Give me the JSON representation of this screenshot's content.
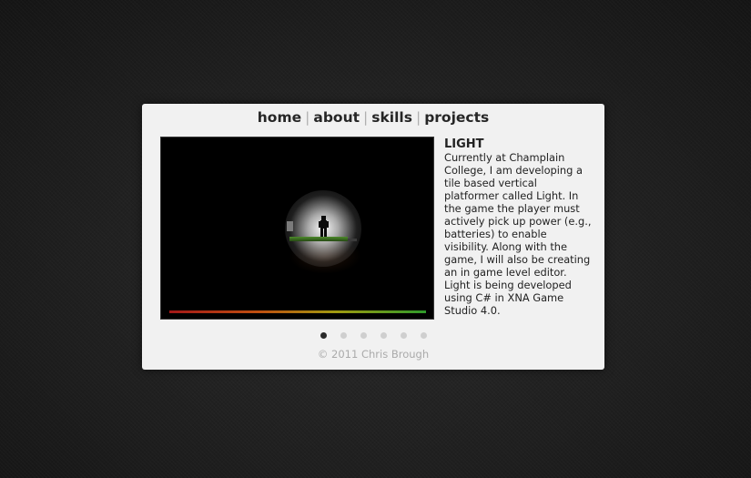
{
  "nav": {
    "items": [
      {
        "label": "home"
      },
      {
        "label": "about"
      },
      {
        "label": "skills"
      },
      {
        "label": "projects"
      }
    ],
    "separator": "|"
  },
  "project": {
    "title": "LIGHT",
    "description": "Currently at Champlain College, I am developing a tile based vertical platformer called Light. In the game the player must actively pick up power (e.g., batteries) to enable visibility. Along with the game, I will also be creating an in game level editor. Light is being developed using C# in XNA Game Studio 4.0."
  },
  "slider": {
    "count": 6,
    "active_index": 0
  },
  "footer": {
    "copyright": "© 2011 Chris Brough"
  },
  "colors": {
    "page_background": "#1f1f1f",
    "card_background": "#f1f1f1",
    "active_dot": "#2a2a2a",
    "inactive_dot": "#cfcfcf"
  }
}
